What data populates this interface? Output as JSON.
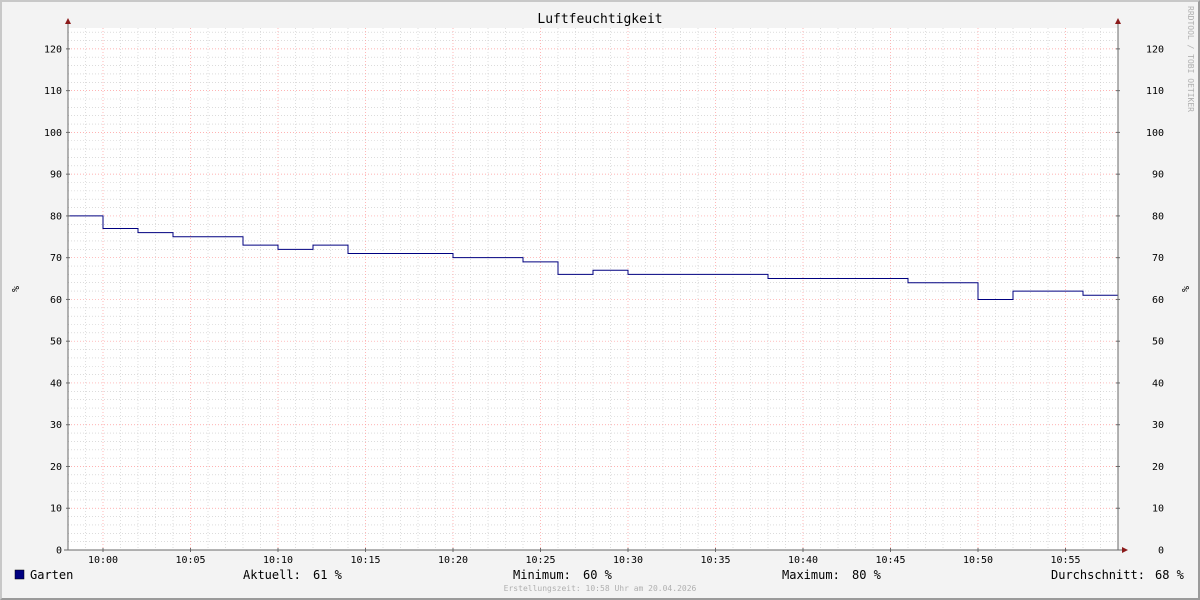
{
  "colors": {
    "background": "#f3f3f3",
    "canvas": "#ffffff",
    "major_grid": "#ff9a9a",
    "minor_grid": "#c8c8c8",
    "axis": "#6a6a6a",
    "arrow": "#8b1a1a",
    "series": "#000080"
  },
  "watermark": "RRDTOOL / TOBI OETIKER",
  "footer": "Erstellungszeit: 10:58 Uhr am 20.04.2026",
  "legend": {
    "series_label": "Garten",
    "current_label": "Aktuell:",
    "current_value": "61 %",
    "min_label": "Minimum:",
    "min_value": "60 %",
    "max_label": "Maximum:",
    "max_value": "80 %",
    "avg_label": "Durchschnitt:",
    "avg_value": "68 %"
  },
  "chart_data": {
    "type": "line",
    "title": "Luftfeuchtigkeit",
    "xlabel": "",
    "ylabel": "%",
    "ylabel_right": "%",
    "xlim": [
      "09:58",
      "10:58"
    ],
    "ylim": [
      0,
      125
    ],
    "y_ticks": [
      0,
      10,
      20,
      30,
      40,
      50,
      60,
      70,
      80,
      90,
      100,
      110,
      120
    ],
    "x_ticks": [
      "10:00",
      "10:05",
      "10:10",
      "10:15",
      "10:20",
      "10:25",
      "10:30",
      "10:35",
      "10:40",
      "10:45",
      "10:50",
      "10:55"
    ],
    "grid": true,
    "step": true,
    "series": [
      {
        "name": "Garten",
        "color": "#000080",
        "points": [
          {
            "x": "09:58",
            "y": 80
          },
          {
            "x": "10:00",
            "y": 77
          },
          {
            "x": "10:02",
            "y": 76
          },
          {
            "x": "10:04",
            "y": 75
          },
          {
            "x": "10:08",
            "y": 73
          },
          {
            "x": "10:10",
            "y": 72
          },
          {
            "x": "10:12",
            "y": 73
          },
          {
            "x": "10:14",
            "y": 71
          },
          {
            "x": "10:20",
            "y": 70
          },
          {
            "x": "10:24",
            "y": 69
          },
          {
            "x": "10:26",
            "y": 66
          },
          {
            "x": "10:28",
            "y": 67
          },
          {
            "x": "10:30",
            "y": 66
          },
          {
            "x": "10:38",
            "y": 65
          },
          {
            "x": "10:46",
            "y": 64
          },
          {
            "x": "10:50",
            "y": 60
          },
          {
            "x": "10:52",
            "y": 62
          },
          {
            "x": "10:56",
            "y": 61
          },
          {
            "x": "10:58",
            "y": 61
          }
        ]
      }
    ]
  }
}
